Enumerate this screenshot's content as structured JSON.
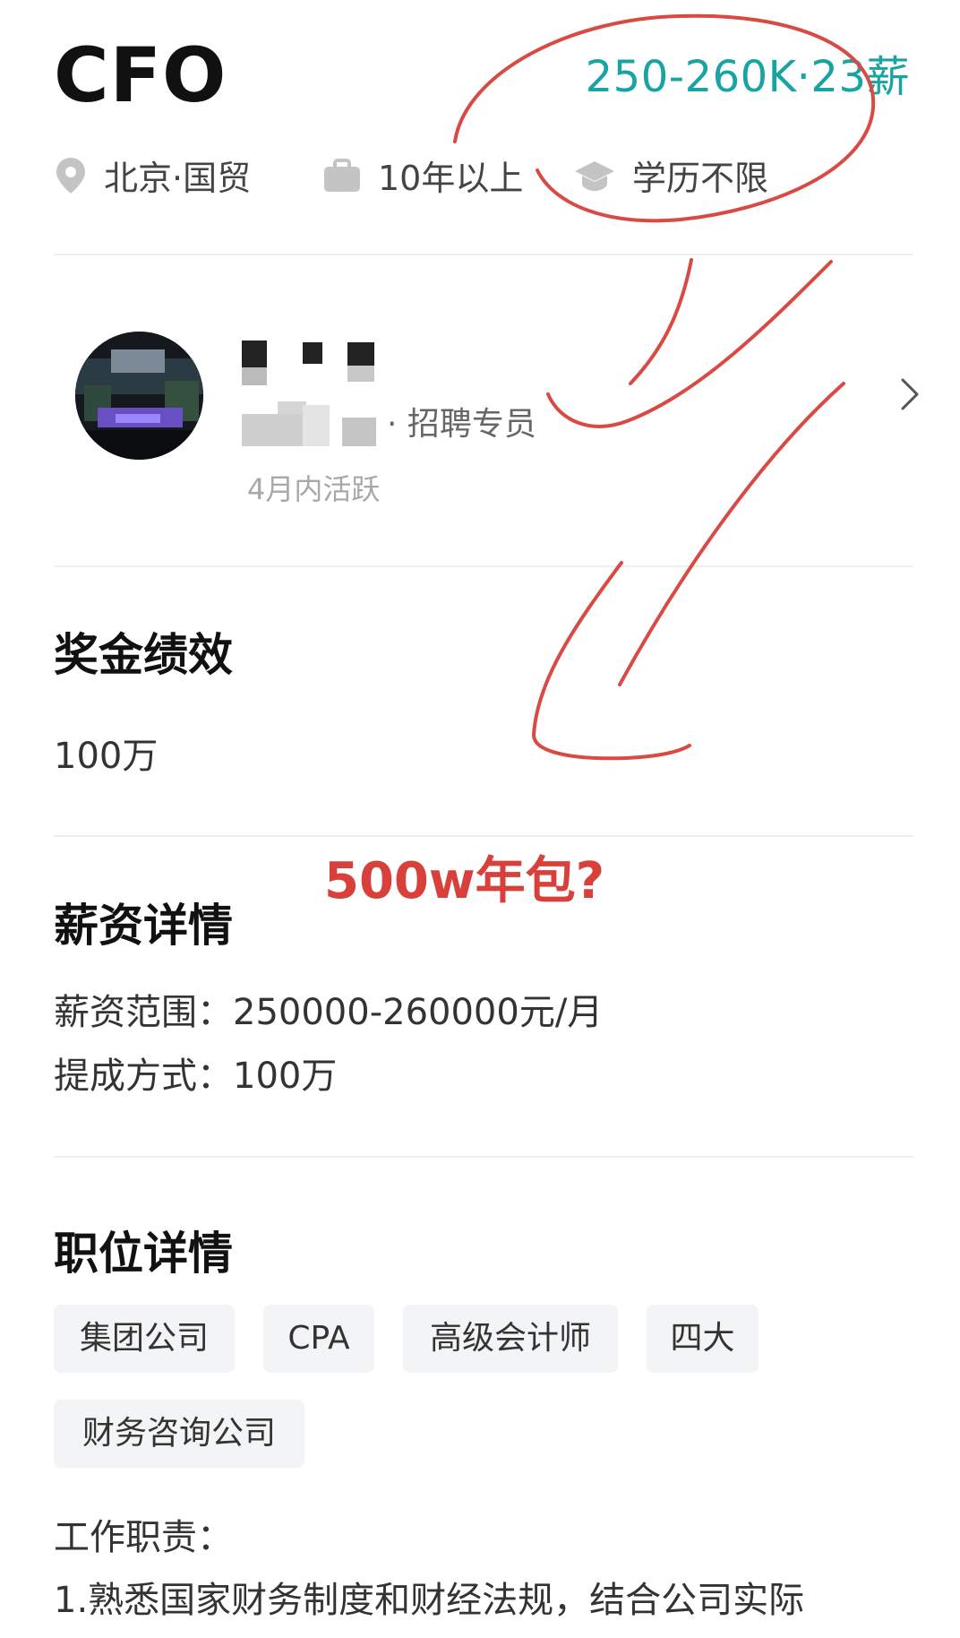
{
  "job": {
    "title": "CFO",
    "salary": "250-260K·23薪",
    "location": "北京·国贸",
    "experience": "10年以上",
    "education": "学历不限"
  },
  "recruiter": {
    "role_suffix": "· 招聘专员",
    "activity": "4月内活跃"
  },
  "bonus": {
    "heading": "奖金绩效",
    "value": "100万"
  },
  "salary_details": {
    "heading": "薪资详情",
    "range_line": "薪资范围：250000-260000元/月",
    "commission_line": "提成方式：100万"
  },
  "position": {
    "heading": "职位详情",
    "tags": [
      "集团公司",
      "CPA",
      "高级会计师",
      "四大",
      "财务咨询公司"
    ],
    "duties_label": "工作职责：",
    "duties_line1": "1.熟悉国家财务制度和财经法规，结合公司实际"
  },
  "annotation": {
    "text": "500w年包?",
    "color": "#d7403b"
  },
  "colors": {
    "salary_accent": "#1aa3a3",
    "annotation_red": "#d7403b"
  },
  "icons": {
    "location": "map-pin-icon",
    "experience": "briefcase-icon",
    "education": "graduation-cap-icon",
    "navigate": "chevron-right-icon"
  }
}
